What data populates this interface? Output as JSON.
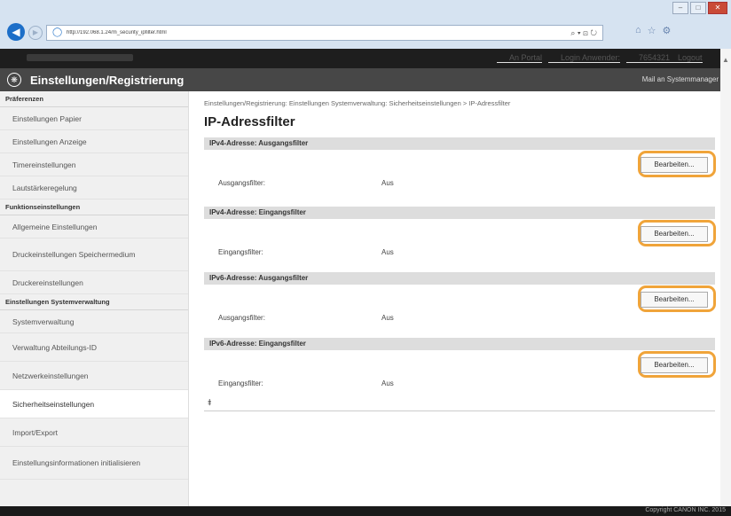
{
  "browser": {
    "url": "http://192.068.1.24/m_security_ipfilter.html",
    "search_tools": "⌕ ▾ ⊡ ↻",
    "window_buttons": [
      "–",
      "□",
      "✕"
    ],
    "home_icons": [
      "⌂",
      "☆",
      "⚙"
    ]
  },
  "topbar": {
    "portal_label": "An Portal",
    "login_label": "Login Anwender:",
    "user_id": "7654321",
    "logout_label": "Logout"
  },
  "titlebar": {
    "title": "Einstellungen/Registrierung",
    "mail_label": "Mail an Systemmanager"
  },
  "sidebar": {
    "sections": [
      {
        "header": "Präferenzen",
        "items": [
          {
            "label": "Einstellungen Papier"
          },
          {
            "label": "Einstellungen Anzeige"
          },
          {
            "label": "Timereinstellungen"
          },
          {
            "label": "Lautstärkeregelung"
          }
        ]
      },
      {
        "header": "Funktionseinstellungen",
        "items": [
          {
            "label": "Allgemeine Einstellungen"
          },
          {
            "label": "Druckeinstellungen Speichermedium"
          },
          {
            "label": "Druckereinstellungen"
          }
        ]
      },
      {
        "header": "Einstellungen Systemverwaltung",
        "items": [
          {
            "label": "Systemverwaltung"
          },
          {
            "label": "Verwaltung Abteilungs-ID"
          },
          {
            "label": "Netzwerkeinstellungen"
          },
          {
            "label": "Sicherheitseinstellungen"
          },
          {
            "label": "Import/Export"
          },
          {
            "label": "Einstellungsinformationen initialisieren"
          }
        ]
      }
    ]
  },
  "main": {
    "breadcrumb": "Einstellungen/Registrierung: Einstellungen Systemverwaltung: Sicherheitseinstellungen > IP-Adressfilter",
    "title": "IP-Adressfilter",
    "panels": [
      {
        "header": "IPv4-Adresse: Ausgangsfilter",
        "button": "Bearbeiten...",
        "field_label": "Ausgangsfilter:",
        "field_value": "Aus"
      },
      {
        "header": "IPv4-Adresse: Eingangsfilter",
        "button": "Bearbeiten...",
        "field_label": "Eingangsfilter:",
        "field_value": "Aus"
      },
      {
        "header": "IPv6-Adresse: Ausgangsfilter",
        "button": "Bearbeiten...",
        "field_label": "Ausgangsfilter:",
        "field_value": "Aus"
      },
      {
        "header": "IPv6-Adresse: Eingangsfilter",
        "button": "Bearbeiten...",
        "field_label": "Eingangsfilter:",
        "field_value": "Aus"
      }
    ],
    "top_link_icon": "⯒"
  },
  "footer": {
    "copyright": "Copyright CANON INC. 2015"
  },
  "colors": {
    "highlight_ring": "#f0a43a",
    "title_bar": "#474747",
    "top_bar": "#1e1e1e"
  }
}
